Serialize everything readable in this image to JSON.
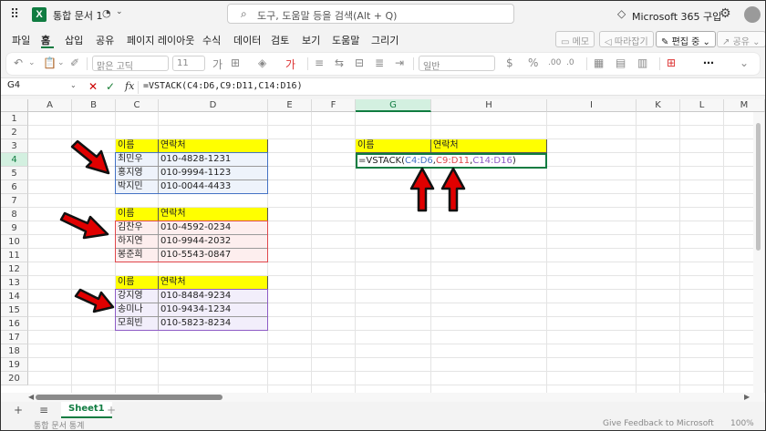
{
  "titlebar": {
    "app_icon": "excel-icon",
    "doc_title": "통합 문서 1",
    "search_placeholder": "도구, 도움말 등을 검색(Alt + Q)",
    "ms365_label": "Microsoft 365 구입"
  },
  "tabs": [
    "파일",
    "홈",
    "삽입",
    "공유",
    "페이지 레이아웃",
    "수식",
    "데이터",
    "검토",
    "보기",
    "도움말",
    "그리기"
  ],
  "ribbon_right": {
    "memo": "메모",
    "catchup": "따라잡기",
    "edit_mode": "편집 중",
    "share": "공유"
  },
  "toolbar": {
    "font_name": "맑은 고딕",
    "font_size": "11",
    "bold_glyph": "가",
    "number_format": "일반",
    "currency_glyph": "$",
    "more_glyph": "⋯"
  },
  "formula_bar": {
    "name_box": "G4",
    "cancel_glyph": "✕",
    "confirm_glyph": "✓",
    "fx_label": "fx",
    "formula": "=VSTACK(C4:D6,C9:D11,C14:D16)"
  },
  "grid": {
    "columns": [
      "A",
      "B",
      "C",
      "D",
      "E",
      "F",
      "G",
      "H",
      "I",
      "K",
      "L",
      "M"
    ],
    "rows": [
      "1",
      "2",
      "3",
      "4",
      "5",
      "6",
      "7",
      "8",
      "9",
      "10",
      "11",
      "12",
      "13",
      "14",
      "15",
      "16",
      "17",
      "18",
      "19",
      "20"
    ],
    "selected_column": "G",
    "selected_row": "4"
  },
  "tables": [
    {
      "header": [
        "이름",
        "연락처"
      ],
      "rows": [
        [
          "최민우",
          "010-4828-1231"
        ],
        [
          "홍지영",
          "010-9994-1123"
        ],
        [
          "박지민",
          "010-0044-4433"
        ]
      ],
      "color": "#4472c4"
    },
    {
      "header": [
        "이름",
        "연락처"
      ],
      "rows": [
        [
          "김찬우",
          "010-4592-0234"
        ],
        [
          "하지연",
          "010-9944-2032"
        ],
        [
          "봉준희",
          "010-5543-0847"
        ]
      ],
      "color": "#e0474c"
    },
    {
      "header": [
        "이름",
        "연락처"
      ],
      "rows": [
        [
          "강지영",
          "010-8484-9234"
        ],
        [
          "송미나",
          "010-9434-1234"
        ],
        [
          "모희빈",
          "010-5823-8234"
        ]
      ],
      "color": "#8e5cc6"
    }
  ],
  "result_table": {
    "header": [
      "이름",
      "연락처"
    ],
    "editing": {
      "prefix": "=VSTACK(",
      "ref1": "C4:D6",
      "sep1": ",",
      "ref2": "C9:D11",
      "sep2": ",",
      "ref3": "C14:D16",
      "suffix": ")"
    }
  },
  "sheetbar": {
    "add_glyph": "+",
    "menu_glyph": "≡",
    "sheet_name": "Sheet1"
  },
  "statusbar": {
    "left": "통합 문서 통계",
    "feedback": "Give Feedback to Microsoft",
    "zoom": "100%"
  },
  "colors": {
    "accent": "#107c41",
    "header_fill": "#ffff00",
    "arrow": "#e00000"
  }
}
